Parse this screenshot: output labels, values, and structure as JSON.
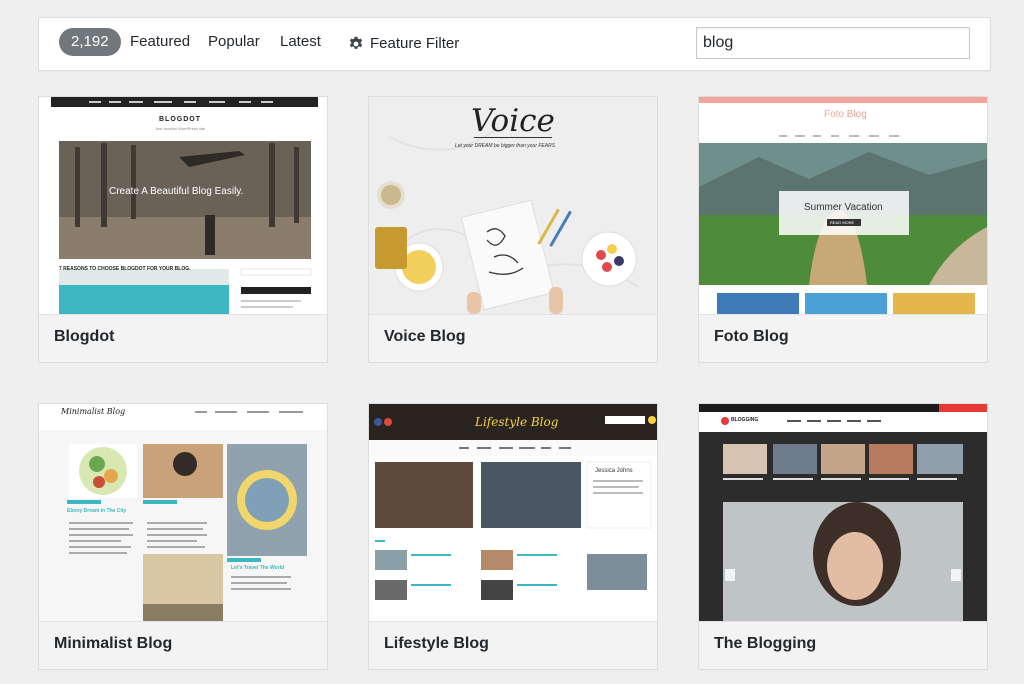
{
  "filter_bar": {
    "count": "2,192",
    "links": [
      "Featured",
      "Popular",
      "Latest"
    ],
    "feature_filter_label": "Feature Filter",
    "feature_filter_icon": "gear-icon",
    "search": {
      "value": "blog"
    }
  },
  "themes": [
    {
      "name": "Blogdot",
      "preview": {
        "site_title": "BLOGDOT",
        "tagline": "Just another WordPress site",
        "hero_text": "Create A Beautiful Blog Easily.",
        "post_heading": "7 REASONS TO CHOOSE BLOGDOT FOR YOUR BLOG."
      }
    },
    {
      "name": "Voice Blog",
      "preview": {
        "title": "Voice",
        "tagline": "Let your DREAM be bigger than your FEARS"
      }
    },
    {
      "name": "Foto Blog",
      "preview": {
        "site_title": "Foto Blog",
        "hero_text": "Summer Vacation",
        "button": "READ MORE"
      }
    },
    {
      "name": "Minimalist Blog",
      "preview": {
        "site_title": "Minimalist Blog",
        "post_1": "Ebony Dream In The City",
        "post_2": "Let's Travel The World"
      }
    },
    {
      "name": "Lifestyle Blog",
      "preview": {
        "site_title": "Lifestyle Blog",
        "author": "Jessica Johns"
      }
    },
    {
      "name": "The Blogging",
      "preview": {
        "site_title": "BLOGGING"
      }
    }
  ],
  "colors": {
    "badge": "#72777c",
    "page_bg": "#efefef",
    "foto_blog_accent": "#f2a39a",
    "lifestyle_accent": "#f5d142",
    "blogging_red": "#e53935"
  }
}
